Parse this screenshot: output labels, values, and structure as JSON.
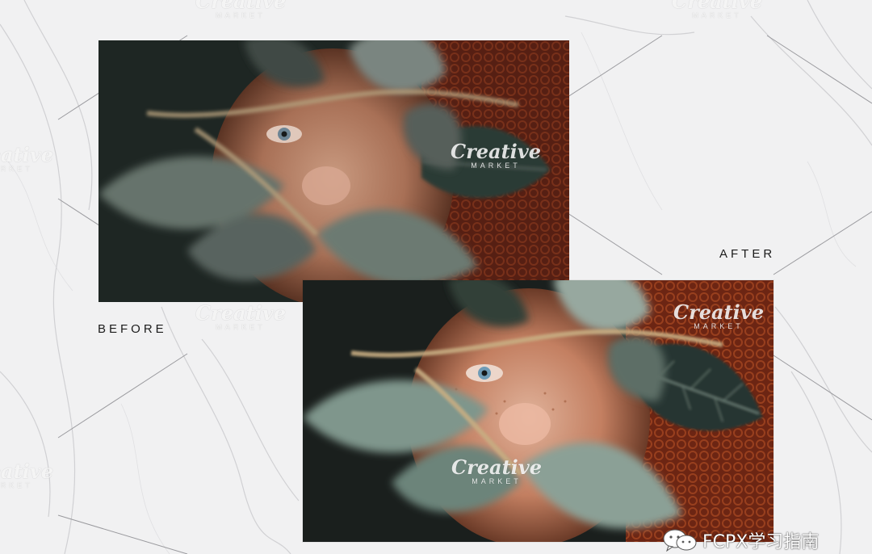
{
  "labels": {
    "before": "BEFORE",
    "after": "AFTER"
  },
  "watermark": {
    "line1": "Creative",
    "line2": "MARKET"
  },
  "footer": {
    "icon": "wechat-icon",
    "text": "FCPX学习指南"
  },
  "colors": {
    "background": "#f1f1f2",
    "label_text": "#1b1b1b",
    "hair": "#7a2814",
    "leaf_before": "#5f6d65",
    "leaf_after": "#7d8f86"
  }
}
